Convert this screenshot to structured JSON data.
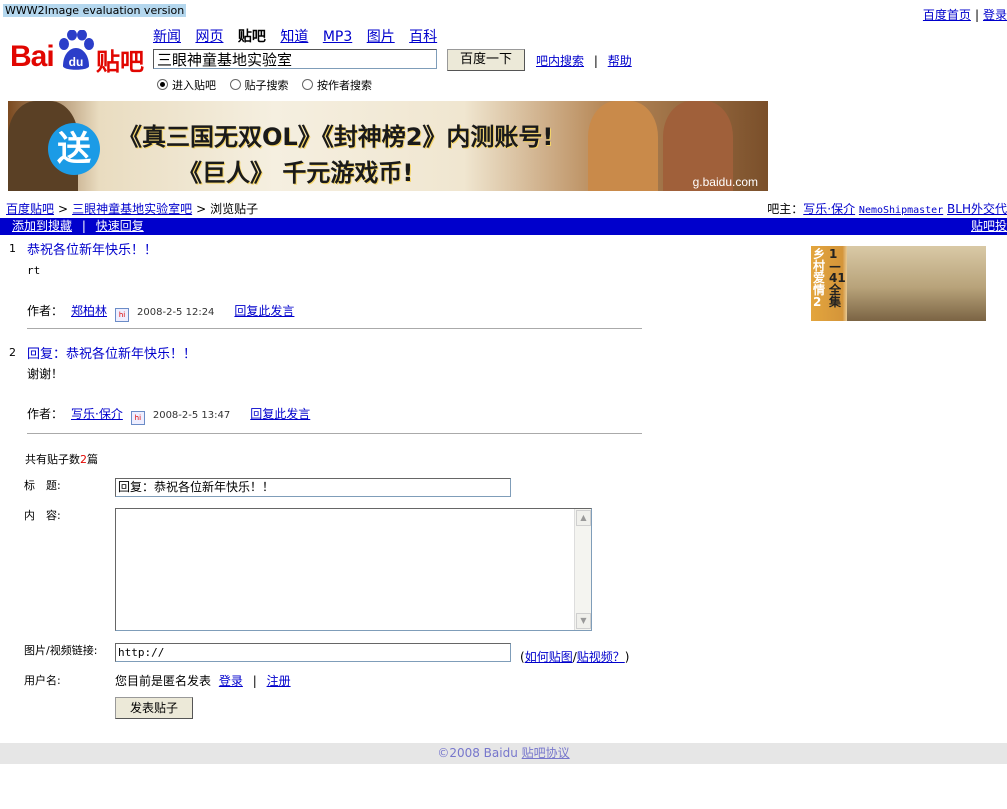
{
  "watermark": "WWW2Image evaluation version",
  "top_links": {
    "home": "百度首页",
    "login": "登录"
  },
  "logo": {
    "bai": "Bai",
    "du": "du",
    "tieba": "贴吧"
  },
  "nav": [
    "新闻",
    "网页",
    "贴吧",
    "知道",
    "MP3",
    "图片",
    "百科"
  ],
  "search": {
    "value": "三眼神童基地实验室",
    "button": "百度一下",
    "in_bar": "吧内搜索",
    "help": "帮助"
  },
  "radios": [
    {
      "label": "进入贴吧",
      "checked": true
    },
    {
      "label": "贴子搜索",
      "checked": false
    },
    {
      "label": "按作者搜索",
      "checked": false
    }
  ],
  "banner": {
    "send": "送",
    "line1": "《真三国无双OL》《封神榜2》内测账号!",
    "line2": "《巨人》 千元游戏币!",
    "domain": "g.baidu.com"
  },
  "breadcrumb": {
    "home": "百度贴吧",
    "bar": "三眼神童基地实验室吧",
    "current": "浏览贴子"
  },
  "admins": {
    "label": "吧主：",
    "a1": "写乐·保介",
    "a2": "NemoShipmaster",
    "a3": "BLH外交代"
  },
  "bluebar": {
    "add_fav": "添加到搜藏",
    "quick_reply": "快速回复",
    "right": "贴吧投"
  },
  "posts": [
    {
      "num": "1",
      "title": "恭祝各位新年快乐！！",
      "body": "rt",
      "author_label": "作者：",
      "author": "郑柏林",
      "hi": "hi",
      "time": "2008-2-5 12:24",
      "reply": "回复此发言"
    },
    {
      "num": "2",
      "title": "回复：恭祝各位新年快乐！！",
      "body": "谢谢！",
      "author_label": "作者：",
      "author": "写乐·保介",
      "hi": "hi",
      "time": "2008-2-5 13:47",
      "reply": "回复此发言"
    }
  ],
  "side_ad": {
    "v1": "乡村爱情2",
    "v2": "1—41全集"
  },
  "count": {
    "pre": "共有贴子数",
    "n": "2",
    "post": "篇"
  },
  "form": {
    "title_label": "标　题:",
    "title_value": "回复：恭祝各位新年快乐！！",
    "content_label": "内　容:",
    "url_label": "图片/视频链接:",
    "url_value": "http://",
    "howto_open": "(",
    "howto_img": "如何贴图",
    "howto_sep": "/",
    "howto_vid": "贴视频？",
    "howto_close": ")",
    "user_label": "用户名:",
    "anon": "您目前是匿名发表",
    "login": "登录",
    "register": "注册",
    "submit": "发表贴子"
  },
  "footer": {
    "copy": "©2008 Baidu",
    "agreement": "贴吧协议"
  }
}
